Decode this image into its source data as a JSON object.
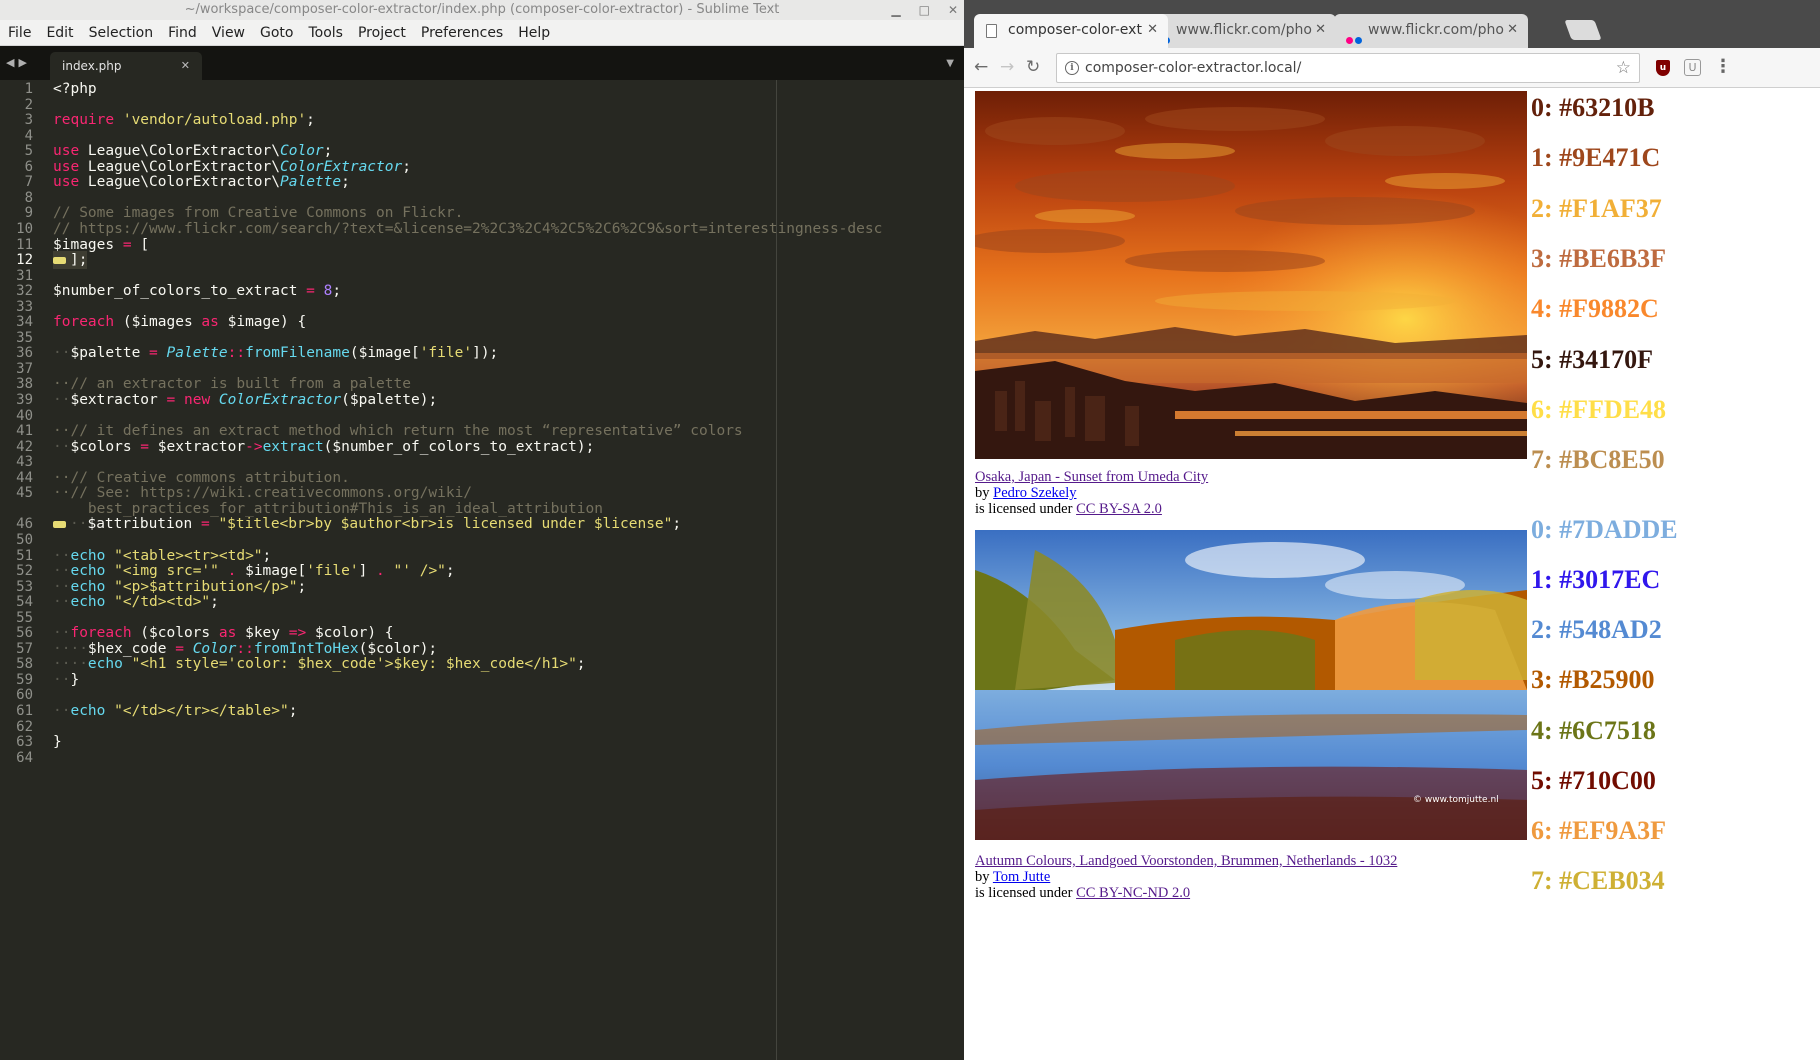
{
  "sublime": {
    "title": "~/workspace/composer-color-extractor/index.php (composer-color-extractor) - Sublime Text",
    "menu": [
      "File",
      "Edit",
      "Selection",
      "Find",
      "View",
      "Goto",
      "Tools",
      "Project",
      "Preferences",
      "Help"
    ],
    "tab_name": "index.php",
    "current_line": "12",
    "line_numbers": [
      "1",
      "2",
      "3",
      "4",
      "5",
      "6",
      "7",
      "8",
      "9",
      "10",
      "11",
      "12",
      "31",
      "32",
      "33",
      "34",
      "35",
      "36",
      "37",
      "38",
      "39",
      "40",
      "41",
      "42",
      "43",
      "44",
      "45",
      "",
      "46",
      "50",
      "51",
      "52",
      "53",
      "54",
      "55",
      "56",
      "57",
      "58",
      "59",
      "60",
      "61",
      "62",
      "63",
      "64"
    ],
    "code_lines": [
      [
        [
          "<?php",
          ""
        ]
      ],
      [],
      [
        [
          "require",
          "kw"
        ],
        [
          " ",
          ""
        ],
        [
          "'vendor/autoload.php'",
          "st"
        ],
        [
          ";",
          ""
        ]
      ],
      [],
      [
        [
          "use",
          "kw"
        ],
        [
          " League\\ColorExtractor\\",
          ""
        ],
        [
          "Color",
          "cls"
        ],
        [
          ";",
          ""
        ]
      ],
      [
        [
          "use",
          "kw"
        ],
        [
          " League\\ColorExtractor\\",
          ""
        ],
        [
          "ColorExtractor",
          "cls"
        ],
        [
          ";",
          ""
        ]
      ],
      [
        [
          "use",
          "kw"
        ],
        [
          " League\\ColorExtractor\\",
          ""
        ],
        [
          "Palette",
          "cls"
        ],
        [
          ";",
          ""
        ]
      ],
      [],
      [
        [
          "// Some images from Creative Commons on Flickr.",
          "cm"
        ]
      ],
      [
        [
          "// https://www.flickr.com/search/?text=&license=2%2C3%2C4%2C5%2C6%2C9&sort=interestingness-desc",
          "cm"
        ]
      ],
      [
        [
          "$images",
          ""
        ],
        [
          " = ",
          "op"
        ],
        [
          "[",
          ""
        ]
      ],
      [
        [
          "FOLD",
          "fold"
        ],
        [
          "];",
          ""
        ]
      ],
      [],
      [
        [
          "$number_of_colors_to_extract",
          ""
        ],
        [
          " = ",
          "op"
        ],
        [
          "8",
          "num"
        ],
        [
          ";",
          ""
        ]
      ],
      [],
      [
        [
          "foreach",
          "kw"
        ],
        [
          " ($images ",
          ""
        ],
        [
          "as",
          "kw"
        ],
        [
          " $image) {",
          ""
        ]
      ],
      [],
      [
        [
          "··",
          "dot"
        ],
        [
          "$palette",
          ""
        ],
        [
          " = ",
          "op"
        ],
        [
          "Palette",
          "cls"
        ],
        [
          "::",
          "op"
        ],
        [
          "fromFilename",
          "fn"
        ],
        [
          "($image[",
          ""
        ],
        [
          "'file'",
          "st"
        ],
        [
          "]);",
          ""
        ]
      ],
      [],
      [
        [
          "··// an extractor is built from a palette",
          "cm"
        ]
      ],
      [
        [
          "··",
          "dot"
        ],
        [
          "$extractor",
          ""
        ],
        [
          " = ",
          "op"
        ],
        [
          "new",
          "kw"
        ],
        [
          " ",
          ""
        ],
        [
          "ColorExtractor",
          "cls"
        ],
        [
          "($palette);",
          ""
        ]
      ],
      [],
      [
        [
          "··// it defines an extract method which return the most “representative” colors",
          "cm"
        ]
      ],
      [
        [
          "··",
          "dot"
        ],
        [
          "$colors",
          ""
        ],
        [
          " = ",
          "op"
        ],
        [
          "$extractor",
          ""
        ],
        [
          "->",
          "op"
        ],
        [
          "extract",
          "fn"
        ],
        [
          "($number_of_colors_to_extract);",
          ""
        ]
      ],
      [],
      [
        [
          "··// Creative commons attribution.",
          "cm"
        ]
      ],
      [
        [
          "··// See: https://wiki.creativecommons.org/wiki/",
          "cm"
        ]
      ],
      [
        [
          "    best_practices_for_attribution#This_is_an_ideal_attribution",
          "cm"
        ]
      ],
      [
        [
          "FOLD",
          "fold"
        ],
        [
          "··",
          "dot"
        ],
        [
          "$attribution",
          ""
        ],
        [
          " = ",
          "op"
        ],
        [
          "\"$title<br>by $author<br>is licensed under $license\"",
          "st"
        ],
        [
          ";",
          ""
        ]
      ],
      [],
      [
        [
          "··",
          "dot"
        ],
        [
          "echo",
          "fn"
        ],
        [
          " ",
          ""
        ],
        [
          "\"<table><tr><td>\"",
          "st"
        ],
        [
          ";",
          ""
        ]
      ],
      [
        [
          "··",
          "dot"
        ],
        [
          "echo",
          "fn"
        ],
        [
          " ",
          ""
        ],
        [
          "\"<img src='\"",
          "st"
        ],
        [
          " . ",
          "op"
        ],
        [
          "$image[",
          ""
        ],
        [
          "'file'",
          "st"
        ],
        [
          "]",
          ""
        ],
        [
          " . ",
          "op"
        ],
        [
          "\"' />\"",
          "st"
        ],
        [
          ";",
          ""
        ]
      ],
      [
        [
          "··",
          "dot"
        ],
        [
          "echo",
          "fn"
        ],
        [
          " ",
          ""
        ],
        [
          "\"<p>$attribution</p>\"",
          "st"
        ],
        [
          ";",
          ""
        ]
      ],
      [
        [
          "··",
          "dot"
        ],
        [
          "echo",
          "fn"
        ],
        [
          " ",
          ""
        ],
        [
          "\"</td><td>\"",
          "st"
        ],
        [
          ";",
          ""
        ]
      ],
      [],
      [
        [
          "··",
          "dot"
        ],
        [
          "foreach",
          "kw"
        ],
        [
          " ($colors ",
          ""
        ],
        [
          "as",
          "kw"
        ],
        [
          " $key ",
          ""
        ],
        [
          "=>",
          "op"
        ],
        [
          " $color) {",
          ""
        ]
      ],
      [
        [
          "····",
          "dot"
        ],
        [
          "$hex_code",
          ""
        ],
        [
          " = ",
          "op"
        ],
        [
          "Color",
          "cls"
        ],
        [
          "::",
          "op"
        ],
        [
          "fromIntToHex",
          "fn"
        ],
        [
          "($color);",
          ""
        ]
      ],
      [
        [
          "····",
          "dot"
        ],
        [
          "echo",
          "fn"
        ],
        [
          " ",
          ""
        ],
        [
          "\"<h1 style='color: $hex_code'>$key: $hex_code</h1>\"",
          "st"
        ],
        [
          ";",
          ""
        ]
      ],
      [
        [
          "··",
          "dot"
        ],
        [
          "}",
          ""
        ]
      ],
      [],
      [
        [
          "··",
          "dot"
        ],
        [
          "echo",
          "fn"
        ],
        [
          " ",
          ""
        ],
        [
          "\"</td></tr></table>\"",
          "st"
        ],
        [
          ";",
          ""
        ]
      ],
      [],
      [
        [
          "}",
          ""
        ]
      ],
      []
    ]
  },
  "chrome": {
    "tabs": [
      {
        "title": "composer-color-ext",
        "icon": "page-icon",
        "active": true
      },
      {
        "title": "www.flickr.com/pho",
        "icon": "flickr-icon",
        "active": false
      },
      {
        "title": "www.flickr.com/pho",
        "icon": "flickr-icon",
        "active": false
      }
    ],
    "url": "composer-color-extractor.local/",
    "extensions": {
      "ublock": "u",
      "other": "U"
    }
  },
  "page": {
    "entries": [
      {
        "title": "Osaka, Japan - Sunset from Umeda City",
        "by_prefix": "by ",
        "author": "Pedro Szekely",
        "license_prefix": "is licensed under ",
        "license": "CC BY-SA 2.0",
        "photo_caption": "",
        "colors": [
          {
            "label": "0: #63210B",
            "hex": "#63210B"
          },
          {
            "label": "1: #9E471C",
            "hex": "#9E471C"
          },
          {
            "label": "2: #F1AF37",
            "hex": "#F1AF37"
          },
          {
            "label": "3: #BE6B3F",
            "hex": "#BE6B3F"
          },
          {
            "label": "4: #F9882C",
            "hex": "#F9882C"
          },
          {
            "label": "5: #34170F",
            "hex": "#34170F"
          },
          {
            "label": "6: #FFDE48",
            "hex": "#FFDE48"
          },
          {
            "label": "7: #BC8E50",
            "hex": "#BC8E50"
          }
        ]
      },
      {
        "title": "Autumn Colours, Landgoed Voorstonden, Brummen, Netherlands - 1032",
        "by_prefix": "by ",
        "author": "Tom Jutte",
        "license_prefix": "is licensed under ",
        "license": "CC BY-NC-ND 2.0",
        "photo_caption": "© www.tomjutte.nl",
        "colors": [
          {
            "label": "0: #7DADDE",
            "hex": "#7DADDE"
          },
          {
            "label": "1: #3017EC",
            "hex": "#3017EC"
          },
          {
            "label": "2: #548AD2",
            "hex": "#548AD2"
          },
          {
            "label": "3: #B25900",
            "hex": "#B25900"
          },
          {
            "label": "4: #6C7518",
            "hex": "#6C7518"
          },
          {
            "label": "5: #710C00",
            "hex": "#710C00"
          },
          {
            "label": "6: #EF9A3F",
            "hex": "#EF9A3F"
          },
          {
            "label": "7: #CEB034",
            "hex": "#CEB034"
          }
        ]
      }
    ]
  }
}
